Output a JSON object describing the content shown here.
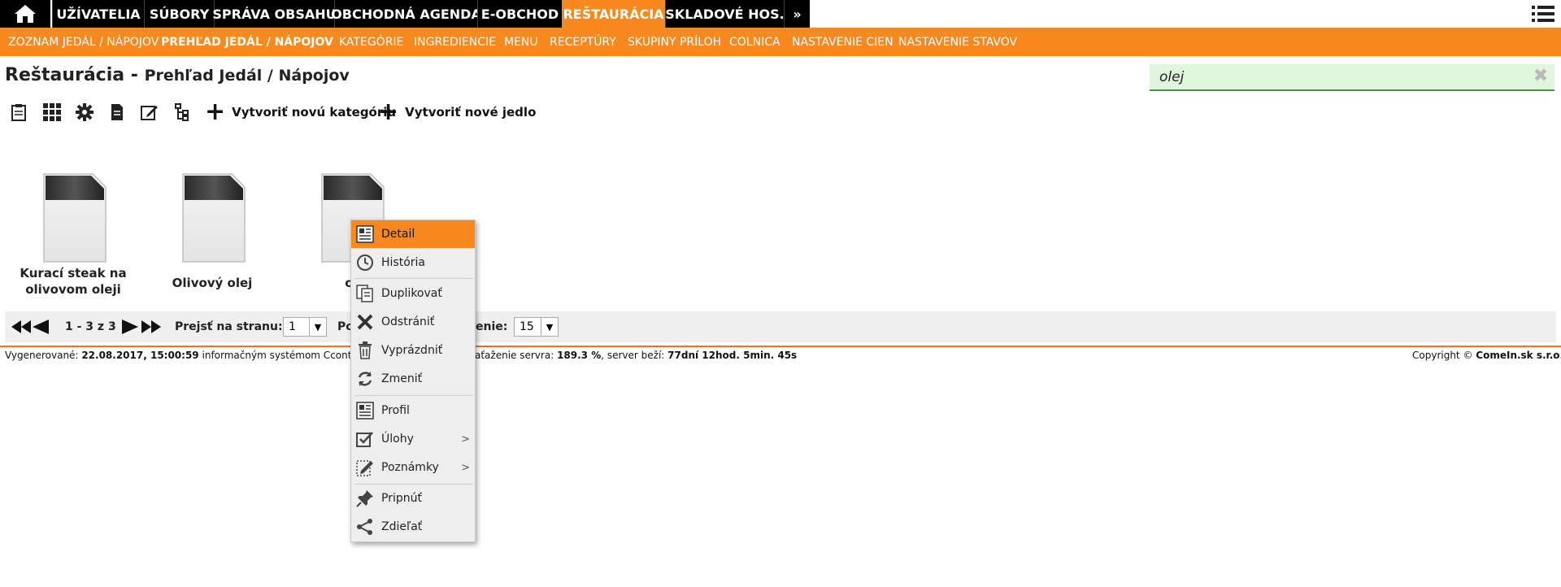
{
  "top_nav": {
    "items": [
      "UŽÍVATELIA",
      "SÚBORY",
      "SPRÁVA OBSAHU",
      "OBCHODNÁ AGENDA",
      "E-OBCHOD",
      "REŠTAURÁCIA",
      "SKLADOVÉ HOS.",
      "»"
    ],
    "active": "REŠTAURÁCIA"
  },
  "sub_nav": {
    "items": [
      "ZOZNAM JEDÁL / NÁPOJOV",
      "PREHĽAD JEDÁL / NÁPOJOV",
      "KATEGÓRIE",
      "INGREDIENCIE",
      "MENU",
      "RECEPTÚRY",
      "SKUPINY PRÍLOH",
      "COLNICA",
      "NASTAVENIE CIEN",
      "NASTAVENIE STAVOV"
    ],
    "active": "PREHĽAD JEDÁL / NÁPOJOV"
  },
  "page": {
    "title": "Reštaurácia",
    "separator": " - ",
    "subtitle": "Prehľad Jedál / Nápojov"
  },
  "search": {
    "value": "olej",
    "clear": "✖"
  },
  "toolbar": {
    "create_category": "Vytvoriť novú kategóriu",
    "create_dish": "Vytvoriť nové jedlo"
  },
  "items": [
    {
      "line1": "Kurací steak na",
      "line2": "olivovom oleji"
    },
    {
      "line1": "Olivový olej",
      "line2": ""
    },
    {
      "line1": "ol",
      "line2": ""
    }
  ],
  "pager": {
    "range": "1 - 3 z 3",
    "goto_label": "Prejsť na stranu:",
    "page_value": "1",
    "per_page_prefix": "Po",
    "per_page_suffix": "enie:",
    "per_page_value": "15"
  },
  "footer": {
    "generated_label": "Vygenerované:",
    "generated_value": "22.08.2017, 15:00:59",
    "system_text": "informačným systémom Ccontroll",
    "load_label": "aťaženie servra:",
    "load_value": "189.3 %",
    "uptime_label": ", server beží:",
    "uptime_value": "77dní 12hod. 5min. 45s",
    "copyright": "Copyright ©",
    "company": "ComeIn.sk s.r.o."
  },
  "context_menu": {
    "items": [
      {
        "label": "Detail",
        "icon": "detail-icon"
      },
      {
        "label": "História",
        "icon": "history-icon"
      },
      {
        "label": "Duplikovať",
        "icon": "duplicate-icon"
      },
      {
        "label": "Odstrániť",
        "icon": "delete-icon"
      },
      {
        "label": "Vyprázdniť",
        "icon": "trash-icon"
      },
      {
        "label": "Zmeniť",
        "icon": "refresh-icon"
      },
      {
        "label": "Profil",
        "icon": "profile-icon"
      },
      {
        "label": "Úlohy",
        "icon": "tasks-icon"
      },
      {
        "label": "Poznámky",
        "icon": "notes-icon"
      },
      {
        "label": "Pripnúť",
        "icon": "pin-icon"
      },
      {
        "label": "Zdieľať",
        "icon": "share-icon"
      }
    ],
    "submenu_arrow": ">"
  },
  "colors": {
    "accent": "#f7891f",
    "nav_bg": "#000000",
    "search_bg": "#e0f6dd"
  }
}
